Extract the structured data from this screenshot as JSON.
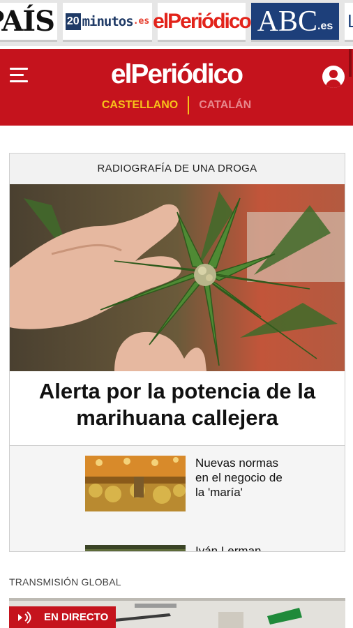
{
  "source_tabs": [
    {
      "label": "PAÍS"
    },
    {
      "label_box": "20",
      "label": "minutos",
      "suffix": ".es"
    },
    {
      "label": "elPeriódico"
    },
    {
      "label": "ABC",
      "suffix": ".es"
    },
    {
      "label": "L"
    }
  ],
  "header": {
    "brand": "elPeriódico",
    "lang_active": "CASTELLANO",
    "lang_inactive": "CATALÁN"
  },
  "main_card": {
    "section": "RADIOGRAFÍA DE UNA DROGA",
    "headline": "Alerta por la potencia de la marihuana callejera",
    "related": [
      {
        "title": "Nuevas normas en el negocio de la 'maría'"
      },
      {
        "title": "Iván Lerman"
      }
    ]
  },
  "section_label": "TRANSMISIÓN GLOBAL",
  "live": {
    "label": "EN DIRECTO"
  },
  "icons": [
    "menu-icon",
    "user-icon",
    "live-broadcast-icon"
  ],
  "colors": {
    "brand_red": "#c5131d",
    "lang_active": "#f7c21a"
  }
}
